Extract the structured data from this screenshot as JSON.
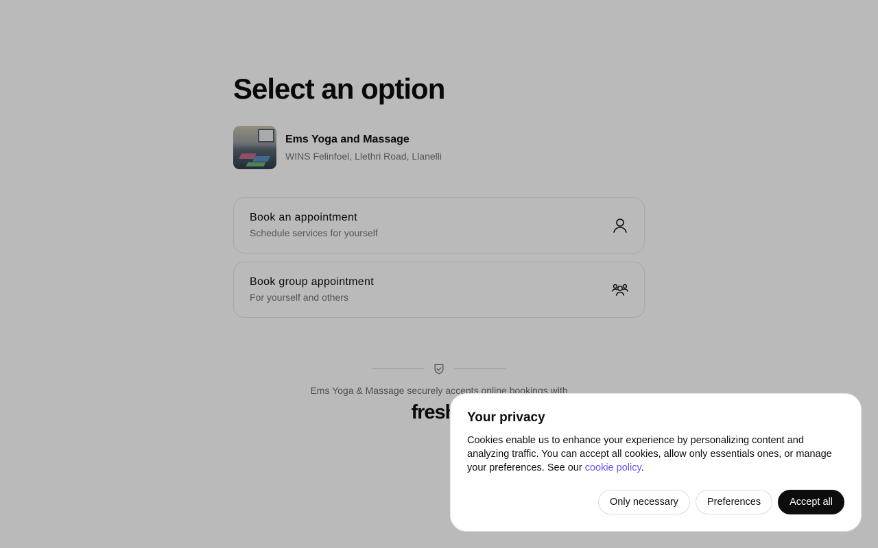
{
  "page": {
    "title": "Select an option"
  },
  "venue": {
    "name": "Ems Yoga and Massage",
    "address": "WINS Felinfoel, Llethri Road, Llanelli"
  },
  "options": [
    {
      "title": "Book an appointment",
      "subtitle": "Schedule services for yourself",
      "icon": "person-icon"
    },
    {
      "title": "Book group appointment",
      "subtitle": "For yourself and others",
      "icon": "group-icon"
    }
  ],
  "footer": {
    "secure_text": "Ems Yoga & Massage securely accepts online bookings with",
    "brand": "fresha",
    "icon": "shield-check-icon"
  },
  "cookie_banner": {
    "title": "Your privacy",
    "body": "Cookies enable us to enhance your experience by personalizing content and analyzing traffic. You can accept all cookies, allow only essentials ones, or manage your preferences. See our ",
    "link_text": "cookie policy",
    "body_end": ".",
    "buttons": {
      "only_necessary": "Only necessary",
      "preferences": "Preferences",
      "accept_all": "Accept all"
    }
  },
  "colors": {
    "accent_link": "#6950f3",
    "primary_button": "#0d0d0d",
    "overlay": "rgba(0,0,0,0.27)"
  }
}
